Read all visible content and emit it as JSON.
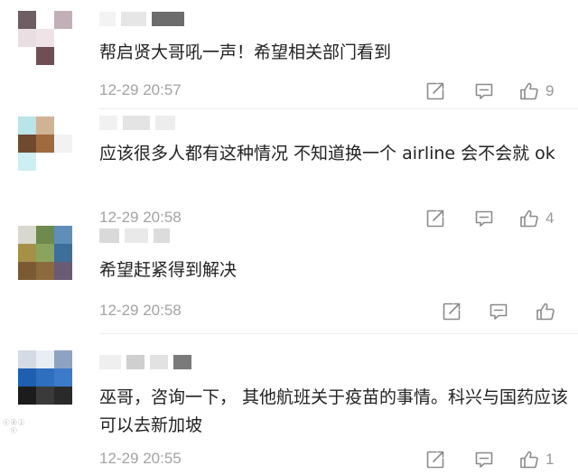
{
  "comments": [
    {
      "text": "帮启贤大哥吼一声！希望相关部门看到",
      "time": "12-29 20:57",
      "likes": "9"
    },
    {
      "text": "应该很多人都有这种情况 不知道换一个 airline 会不会就 ok",
      "time": "12-29 20:58",
      "likes": "4"
    },
    {
      "text": "希望赶紧得到解决",
      "time": "12-29 20:58",
      "likes": ""
    },
    {
      "text": "巫哥，咨询一下， 其他航班关于疫苗的事情。科兴与国药应该可以去新加坡",
      "time": "12-29 20:55",
      "likes": "1"
    }
  ],
  "icons": {
    "share": "share-icon",
    "comment": "comment-icon",
    "like": "thumbs-up-icon"
  },
  "colors": {
    "text": "#222222",
    "meta": "#a3a3a3",
    "icon": "#8a8a8a",
    "divider": "#ececec"
  },
  "watermark": "ⓒ ⓓ ⓙ ⓒ"
}
